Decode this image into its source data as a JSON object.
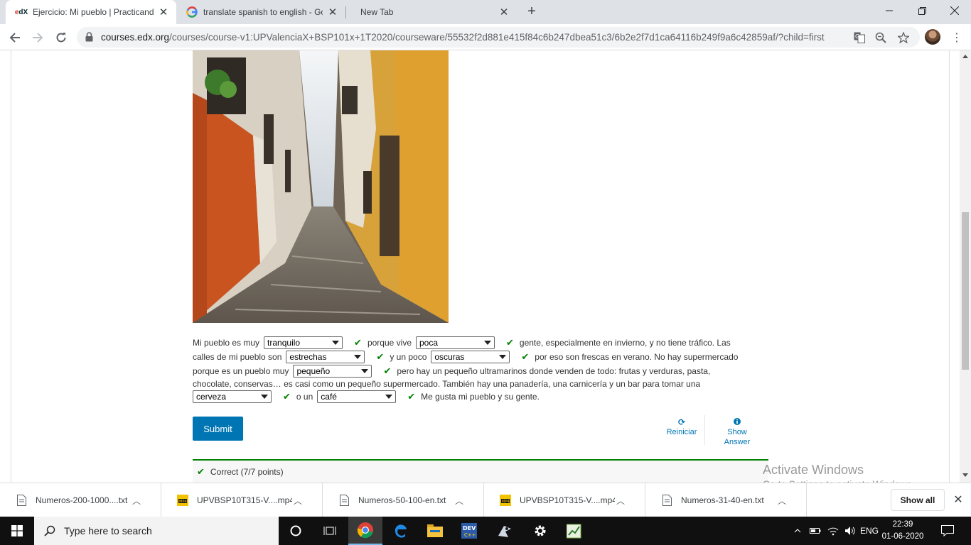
{
  "browser": {
    "tabs": [
      {
        "title": "Ejercicio: Mi pueblo | Practicando",
        "favicon": "edX",
        "active": true
      },
      {
        "title": "translate spanish to english - Goo",
        "favicon": "google-icon",
        "active": false
      },
      {
        "title": "New Tab",
        "favicon": "",
        "active": false
      }
    ],
    "url_host": "courses.edx.org",
    "url_path": "/courses/course-v1:UPValenciaX+BSP101x+1T2020/courseware/55532f2d881e415f84c6b247dbea51c3/6b2e2f7d1ca64116b249f9a6c42859af/?child=first"
  },
  "exercise": {
    "segments": {
      "s1": "Mi pueblo es muy",
      "s2": "porque vive",
      "s3": "gente, especialmente en invierno, y no tiene tráfico. Las",
      "s4": "calles de mi pueblo son",
      "s5": "y un poco",
      "s6": "por eso son frescas en verano. No hay supermercado",
      "s7": "porque es un pueblo muy",
      "s8": "pero hay un pequeño ultramarinos donde venden de todo: frutas y verduras, pasta,",
      "s9": "chocolate, conservas… es casi como un pequeño supermercado. También hay una panadería, una carnicería y un bar para tomar una",
      "s10": "o un",
      "s11": "Me gusta mi pueblo y su gente."
    },
    "selects": {
      "d1": "tranquilo",
      "d2": "poca",
      "d3": "estrechas",
      "d4": "oscuras",
      "d5": "pequeño",
      "d6": "cerveza",
      "d7": "café"
    },
    "submit_label": "Submit",
    "reset_label": "Reiniciar",
    "show_answer_label_1": "Show",
    "show_answer_label_2": "Answer",
    "feedback": "Correct (7/7 points)"
  },
  "watermark": {
    "line1": "Activate Windows",
    "line2": "Go to Settings to activate Windows."
  },
  "downloads": {
    "items": [
      {
        "name": "Numeros-200-1000....txt",
        "type": "txt"
      },
      {
        "name": "UPVBSP10T315-V....mp4",
        "type": "mp4"
      },
      {
        "name": "Numeros-50-100-en.txt",
        "type": "txt"
      },
      {
        "name": "UPVBSP10T315-V....mp4",
        "type": "mp4"
      },
      {
        "name": "Numeros-31-40-en.txt",
        "type": "txt"
      }
    ],
    "show_all": "Show all"
  },
  "taskbar": {
    "search_placeholder": "Type here to search",
    "language": "ENG",
    "time": "22:39",
    "date": "01-06-2020"
  },
  "colors": {
    "accent": "#0075b4",
    "correct": "#008100"
  }
}
